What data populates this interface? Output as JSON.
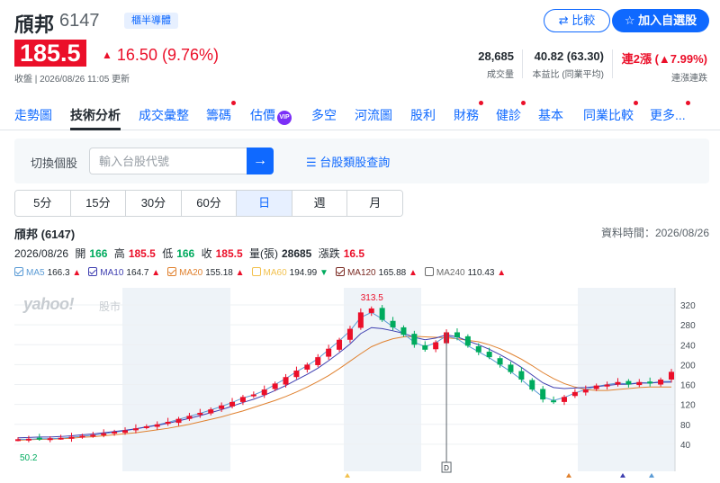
{
  "header": {
    "name": "頎邦",
    "code": "6147",
    "market_badge": "櫃半導體",
    "compare_label": "比較",
    "watchlist_label": "加入自選股"
  },
  "quote": {
    "price": "185.5",
    "change": "16.50 (9.76%)",
    "closed_note": "收盤 | 2026/08/26 11:05 更新",
    "volume": "28,685",
    "volume_label": "成交量",
    "pe": "40.82 (63.30)",
    "pe_label": "本益比 (同業平均)",
    "streak": "連2漲 (▲7.99%)",
    "streak_label": "連漲連跌"
  },
  "tabs": [
    {
      "label": "走勢圖",
      "dot": false
    },
    {
      "label": "技術分析",
      "dot": false,
      "active": true
    },
    {
      "label": "成交彙整",
      "dot": false
    },
    {
      "label": "籌碼",
      "dot": true
    },
    {
      "label": "估價",
      "dot": false,
      "vip": true
    },
    {
      "label": "多空",
      "dot": false
    },
    {
      "label": "河流圖",
      "dot": false
    },
    {
      "label": "股利",
      "dot": false
    },
    {
      "label": "財務",
      "dot": true
    },
    {
      "label": "健診",
      "dot": true
    },
    {
      "label": "基本",
      "dot": false
    },
    {
      "label": "同業比較",
      "dot": true
    },
    {
      "label": "更多...",
      "dot": true
    }
  ],
  "search": {
    "label": "切換個股",
    "placeholder": "輸入台股代號",
    "category_link": "台股類股查詢"
  },
  "periods": [
    {
      "label": "5分"
    },
    {
      "label": "15分"
    },
    {
      "label": "30分"
    },
    {
      "label": "60分"
    },
    {
      "label": "日",
      "active": true
    },
    {
      "label": "週"
    },
    {
      "label": "月"
    }
  ],
  "chart_info": {
    "title": "頎邦 (6147)",
    "data_time": "資料時間：2026/08/26",
    "date": "2026/08/26",
    "open_label": "開",
    "open": "166",
    "high_label": "高",
    "high": "185.5",
    "low_label": "低",
    "low": "166",
    "close_label": "收",
    "close": "185.5",
    "vol_label": "量(張)",
    "vol": "28685",
    "chg_label": "漲跌",
    "chg": "16.5"
  },
  "ma": [
    {
      "name": "MA5",
      "value": "166.3",
      "dir": "up",
      "color": "#5b9bd5"
    },
    {
      "name": "MA10",
      "value": "164.7",
      "dir": "up",
      "color": "#3f3fb0"
    },
    {
      "name": "MA20",
      "value": "155.18",
      "dir": "up",
      "color": "#e0812f"
    },
    {
      "name": "MA60",
      "value": "194.99",
      "dir": "down",
      "color": "#f2c14e"
    },
    {
      "name": "MA120",
      "value": "165.88",
      "dir": "up",
      "color": "#7a2a22"
    },
    {
      "name": "MA240",
      "value": "110.43",
      "dir": "up",
      "color": "#6b6b6b"
    }
  ],
  "watermark": {
    "brand": "yahoo!",
    "sub": "股市"
  },
  "colors": {
    "up": "#eb0f29",
    "down": "#00ab5e",
    "accent": "#0f69ff"
  },
  "chart_data": {
    "type": "line",
    "y_ticks": [
      40,
      80,
      120,
      160,
      200,
      240,
      280,
      320
    ],
    "ylim": [
      0,
      340
    ],
    "annotations": [
      {
        "label": "313.5",
        "kind": "max"
      },
      {
        "label": "50.2",
        "kind": "min"
      },
      {
        "label": "D",
        "kind": "marker"
      }
    ],
    "close": [
      50,
      51,
      51,
      52,
      53,
      55,
      57,
      59,
      62,
      65,
      68,
      72,
      76,
      80,
      85,
      91,
      97,
      103,
      110,
      118,
      125,
      135,
      140,
      150,
      162,
      175,
      188,
      200,
      215,
      232,
      250,
      272,
      305,
      313,
      290,
      275,
      260,
      240,
      230,
      245,
      265,
      255,
      238,
      225,
      215,
      200,
      185,
      170,
      150,
      130,
      125,
      135,
      145,
      150,
      158,
      160,
      165,
      160,
      165,
      162,
      170,
      185.5
    ],
    "series": [
      {
        "name": "MA20",
        "values": [
          48,
          49,
          50,
          50,
          51,
          52,
          54,
          55,
          57,
          59,
          61,
          63,
          66,
          69,
          72,
          76,
          80,
          85,
          90,
          95,
          101,
          107,
          114,
          121,
          128,
          136,
          145,
          155,
          166,
          178,
          192,
          207,
          222,
          236,
          245,
          252,
          256,
          257,
          256,
          255,
          254,
          252,
          249,
          246,
          240,
          232,
          222,
          211,
          198,
          184,
          172,
          162,
          155,
          150,
          148,
          148,
          150,
          152,
          154,
          155,
          155,
          155.18
        ]
      },
      {
        "name": "MA5",
        "values": [
          50,
          50,
          51,
          51,
          52,
          54,
          56,
          58,
          61,
          64,
          67,
          71,
          75,
          79,
          84,
          90,
          96,
          102,
          109,
          116,
          124,
          133,
          139,
          148,
          160,
          172,
          186,
          198,
          212,
          230,
          248,
          268,
          295,
          305,
          292,
          276,
          262,
          245,
          236,
          244,
          258,
          252,
          238,
          226,
          214,
          200,
          186,
          170,
          152,
          135,
          128,
          134,
          143,
          150,
          156,
          160,
          163,
          161,
          164,
          163,
          166,
          166.3
        ]
      }
    ]
  }
}
